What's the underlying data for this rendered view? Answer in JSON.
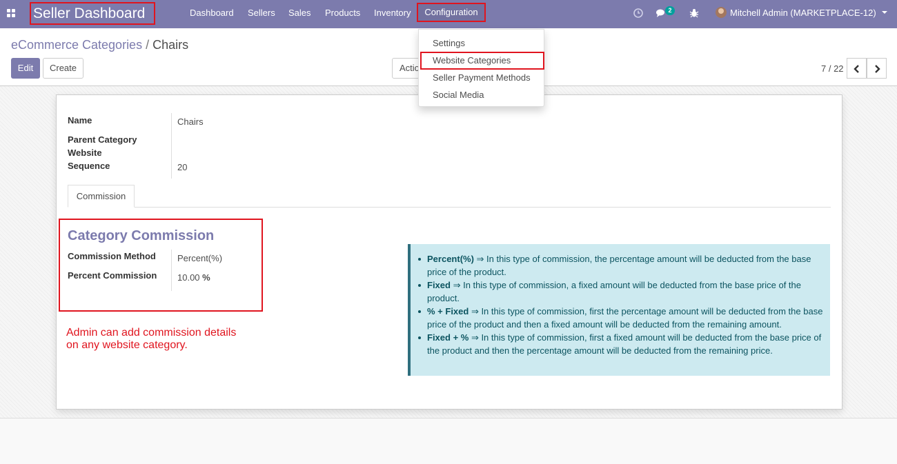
{
  "navbar": {
    "brand": "Seller Dashboard",
    "menu": [
      "Dashboard",
      "Sellers",
      "Sales",
      "Products",
      "Inventory"
    ],
    "config_label": "Configuration",
    "chat_badge": "2",
    "user": "Mitchell Admin (MARKETPLACE-12)",
    "icons": [
      "apps-icon",
      "clock-icon",
      "chat-icon",
      "bug-icon",
      "user-avatar",
      "caret-down-icon"
    ]
  },
  "control_panel": {
    "breadcrumb_parent": "eCommerce Categories",
    "breadcrumb_sep": "/",
    "breadcrumb_current": "Chairs",
    "edit_label": "Edit",
    "create_label": "Create",
    "action_label": "Actio",
    "pager": "7 / 22"
  },
  "dropdown": {
    "items": [
      "Settings",
      "Website Categories",
      "Seller Payment Methods",
      "Social Media"
    ]
  },
  "form": {
    "name_label": "Name",
    "name_value": "Chairs",
    "parent_label": "Parent Category",
    "website_label": "Website",
    "sequence_label": "Sequence",
    "sequence_value": "20",
    "tab_label": "Commission",
    "section_title": "Category Commission",
    "method_label": "Commission Method",
    "method_value": "Percent(%)",
    "percent_label": "Percent Commission",
    "percent_value": "10.00",
    "percent_unit": "%",
    "note_line1": "Admin can add commission details",
    "note_line2": "on any website category."
  },
  "info": [
    {
      "term": "Percent(%)",
      "text": " ⇒ In this type of commission, the percentage amount will be deducted from the base price of the product."
    },
    {
      "term": "Fixed",
      "text": " ⇒ In this type of commission, a fixed amount will be deducted from the base price of the product."
    },
    {
      "term": "% + Fixed",
      "text": " ⇒ In this type of commission, first the percentage amount will be deducted from the base price of the product and then a fixed amount will be deducted from the remaining amount."
    },
    {
      "term": "Fixed + %",
      "text": " ⇒ In this type of commission, first a fixed amount will be deducted from the base price of the product and then the percentage amount will be deducted from the remaining price."
    }
  ],
  "colors": {
    "primary": "#7c7bad",
    "highlight_red": "#e0141e",
    "info_bg": "#cdeaf0",
    "badge": "#00a09d"
  }
}
